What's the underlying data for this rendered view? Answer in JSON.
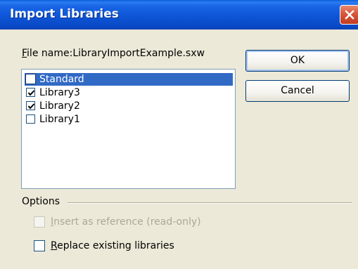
{
  "window": {
    "title": "Import Libraries"
  },
  "file": {
    "label_prefix": "F",
    "label_rest": "ile name:",
    "filename": "LibraryImportExample.sxw"
  },
  "libraries": {
    "items": [
      {
        "label": "Standard",
        "checked": false,
        "selected": true
      },
      {
        "label": "Library3",
        "checked": true,
        "selected": false
      },
      {
        "label": "Library2",
        "checked": true,
        "selected": false
      },
      {
        "label": "Library1",
        "checked": false,
        "selected": false
      }
    ]
  },
  "buttons": {
    "ok": "OK",
    "cancel": "Cancel"
  },
  "options": {
    "heading": "Options",
    "insert_reference": {
      "mnemonic": "I",
      "rest": "nsert as reference (read-only)",
      "checked": false,
      "enabled": false
    },
    "replace_existing": {
      "mnemonic": "R",
      "rest": "eplace existing libraries",
      "checked": false,
      "enabled": true
    }
  },
  "colors": {
    "titlebar": "#0a4ac8",
    "selection": "#316ac5",
    "dialog_bg": "#ece9d8"
  }
}
